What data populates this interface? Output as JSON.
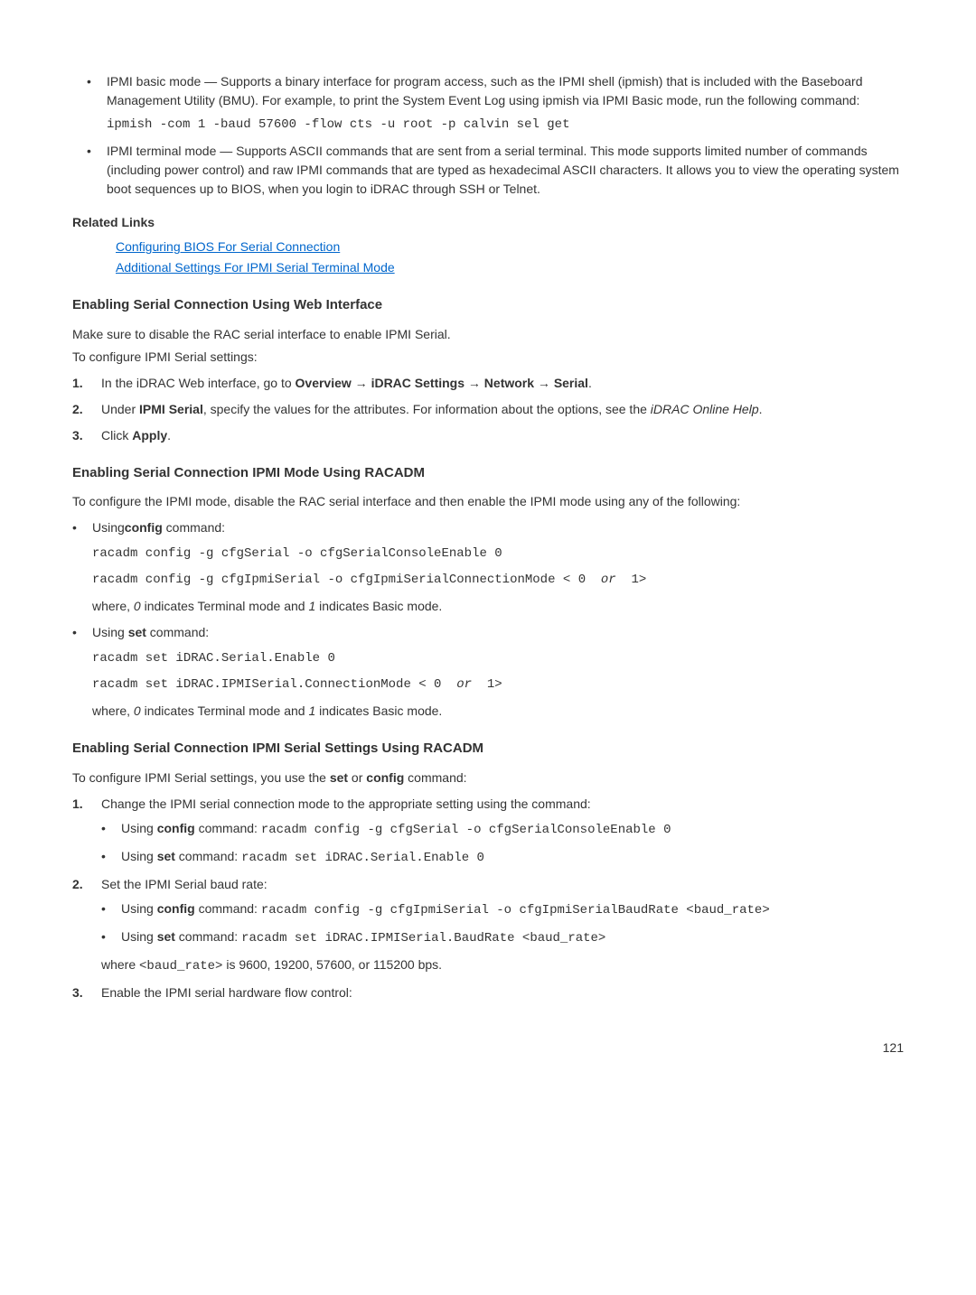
{
  "topBullets": {
    "b1_text": "IPMI basic mode — Supports a binary interface for program access, such as the IPMI shell (ipmish) that is included with the Baseboard Management Utility (BMU). For example, to print the System Event Log using ipmish via IPMI Basic mode, run the following command:",
    "b1_code": "ipmish -com 1 -baud 57600 -flow cts -u root -p calvin sel get",
    "b2_text": "IPMI terminal mode — Supports ASCII commands that are sent from a serial terminal. This mode supports limited number of commands (including power control) and raw IPMI commands that are typed as hexadecimal ASCII characters. It allows you to view the operating system boot sequences up to BIOS, when you login to iDRAC through SSH or Telnet."
  },
  "relatedLinks": {
    "heading": "Related Links",
    "link1": "Configuring BIOS For Serial Connection",
    "link2": "Additional Settings For IPMI Serial Terminal Mode"
  },
  "sec1": {
    "heading": "Enabling Serial Connection Using Web Interface",
    "p1": "Make sure to disable the RAC serial interface to enable IPMI Serial.",
    "p2": "To configure IPMI Serial settings:",
    "li1_pre": "In the iDRAC Web interface, go to ",
    "li1_b1": "Overview",
    "li1_a1": " → ",
    "li1_b2": "iDRAC Settings",
    "li1_a2": " → ",
    "li1_b3": "Network",
    "li1_a3": " → ",
    "li1_b4": "Serial",
    "li1_post": ".",
    "li2_pre": "Under ",
    "li2_b1": "IPMI Serial",
    "li2_mid": ", specify the values for the attributes. For information about the options, see the ",
    "li2_i": "iDRAC Online Help",
    "li2_post": ".",
    "li3_pre": "Click ",
    "li3_b": "Apply",
    "li3_post": "."
  },
  "sec2": {
    "heading": "Enabling Serial Connection IPMI Mode Using RACADM",
    "p1": "To configure the IPMI mode, disable the RAC serial interface and then enable the IPMI mode using any of the following:",
    "b1_pre": "Using",
    "b1_bold": "config",
    "b1_post": " command:",
    "b1_code1": "racadm config -g cfgSerial -o cfgSerialConsoleEnable 0",
    "b1_code2_a": "racadm config -g cfgIpmiSerial -o cfgIpmiSerialConnectionMode < 0  ",
    "b1_code2_i": "or",
    "b1_code2_b": "  1>",
    "b1_where_a": "where, ",
    "b1_where_i1": "0",
    "b1_where_b": " indicates Terminal mode and ",
    "b1_where_i2": "1",
    "b1_where_c": " indicates Basic mode.",
    "b2_pre": "Using ",
    "b2_bold": "set",
    "b2_post": " command:",
    "b2_code1": "racadm set iDRAC.Serial.Enable 0",
    "b2_code2_a": "racadm set iDRAC.IPMISerial.ConnectionMode < 0  ",
    "b2_code2_i": "or",
    "b2_code2_b": "  1>",
    "b2_where_a": "where, ",
    "b2_where_i1": "0",
    "b2_where_b": " indicates Terminal mode and ",
    "b2_where_i2": "1",
    "b2_where_c": " indicates Basic mode."
  },
  "sec3": {
    "heading": "Enabling Serial Connection IPMI Serial Settings Using RACADM",
    "p1_a": "To configure IPMI Serial settings, you use the ",
    "p1_b1": "set",
    "p1_b": " or ",
    "p1_b2": "config",
    "p1_c": " command:",
    "li1": "Change the IPMI serial connection mode to the appropriate setting using the command:",
    "li1_sub1_a": "Using ",
    "li1_sub1_b": "config",
    "li1_sub1_c": " command: ",
    "li1_sub1_code": "racadm config -g cfgSerial -o cfgSerialConsoleEnable 0",
    "li1_sub2_a": "Using ",
    "li1_sub2_b": "set",
    "li1_sub2_c": " command: ",
    "li1_sub2_code": "racadm set iDRAC.Serial.Enable 0",
    "li2": "Set the IPMI Serial baud rate:",
    "li2_sub1_a": "Using ",
    "li2_sub1_b": "config",
    "li2_sub1_c": " command: ",
    "li2_sub1_code": "racadm config -g cfgIpmiSerial -o cfgIpmiSerialBaudRate <baud_rate>",
    "li2_sub2_a": "Using ",
    "li2_sub2_b": "set",
    "li2_sub2_c": " command: ",
    "li2_sub2_code": "racadm set iDRAC.IPMISerial.BaudRate <baud_rate>",
    "li2_where_a": "where ",
    "li2_where_code": "<baud_rate>",
    "li2_where_b": " is 9600, 19200, 57600, or 115200 bps.",
    "li3": "Enable the IPMI serial hardware flow control:"
  },
  "pageNumber": "121"
}
